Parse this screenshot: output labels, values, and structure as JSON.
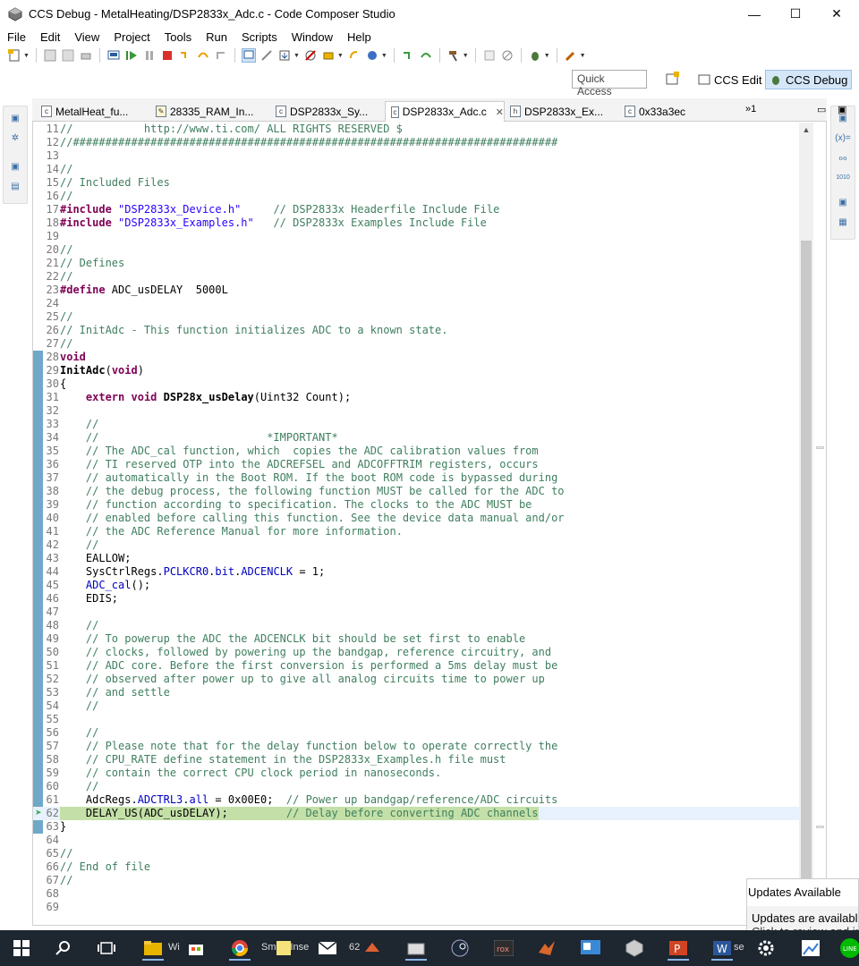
{
  "window": {
    "title": "CCS Debug - MetalHeating/DSP2833x_Adc.c - Code Composer Studio",
    "minimize": "—",
    "maximize": "☐",
    "close": "✕"
  },
  "menu": [
    "File",
    "Edit",
    "View",
    "Project",
    "Tools",
    "Run",
    "Scripts",
    "Window",
    "Help"
  ],
  "perspectives": {
    "quick_access": "Quick Access",
    "ccs_edit": "CCS Edit",
    "ccs_debug": "CCS Debug"
  },
  "tabs": [
    {
      "label": "MetalHeat_fu...",
      "icon": "c"
    },
    {
      "label": "28335_RAM_In...",
      "icon": "cmd"
    },
    {
      "label": "DSP2833x_Sy...",
      "icon": "c"
    },
    {
      "label": "DSP2833x_Adc.c",
      "icon": "c",
      "active": true
    },
    {
      "label": "DSP2833x_Ex...",
      "icon": "h"
    },
    {
      "label": "0x33a3ec",
      "icon": "c"
    }
  ],
  "tab_overflow": "»1",
  "code_lines": [
    {
      "n": "11",
      "html": "<span class=\"cm\">//           http://www.ti.com/ ALL RIGHTS RESERVED $</span>"
    },
    {
      "n": "12",
      "html": "<span class=\"cm\">//###########################################################################</span>"
    },
    {
      "n": "13",
      "html": ""
    },
    {
      "n": "14",
      "html": "<span class=\"cm\">//</span>"
    },
    {
      "n": "15",
      "html": "<span class=\"cm\">// Included Files</span>"
    },
    {
      "n": "16",
      "html": "<span class=\"cm\">//</span>"
    },
    {
      "n": "17",
      "html": "<span class=\"kw\">#include</span> <span class=\"st\">\"DSP2833x_Device.h\"</span>     <span class=\"cm\">// DSP2833x Headerfile Include File</span>"
    },
    {
      "n": "18",
      "html": "<span class=\"kw\">#include</span> <span class=\"st\">\"DSP2833x_Examples.h\"</span>   <span class=\"cm\">// DSP2833x Examples Include File</span>"
    },
    {
      "n": "19",
      "html": ""
    },
    {
      "n": "20",
      "html": "<span class=\"cm\">//</span>"
    },
    {
      "n": "21",
      "html": "<span class=\"cm\">// Defines</span>"
    },
    {
      "n": "22",
      "html": "<span class=\"cm\">//</span>"
    },
    {
      "n": "23",
      "html": "<span class=\"kw\">#define</span> ADC_usDELAY  5000L"
    },
    {
      "n": "24",
      "html": ""
    },
    {
      "n": "25",
      "html": "<span class=\"cm\">//</span>"
    },
    {
      "n": "26",
      "html": "<span class=\"cm\">// InitAdc - This function initializes ADC to a known state.</span>"
    },
    {
      "n": "27",
      "html": "<span class=\"cm\">//</span>"
    },
    {
      "n": "28",
      "html": "<span class=\"kw\">void</span>"
    },
    {
      "n": "29",
      "html": "<span class=\"fn\">InitAdc</span>(<span class=\"kw\">void</span>)"
    },
    {
      "n": "30",
      "html": "{"
    },
    {
      "n": "31",
      "html": "    <span class=\"kw\">extern</span> <span class=\"kw\">void</span> <span class=\"fn\">DSP28x_usDelay</span>(Uint32 Count);"
    },
    {
      "n": "32",
      "html": ""
    },
    {
      "n": "33",
      "html": "    <span class=\"cm\">//</span>"
    },
    {
      "n": "34",
      "html": "    <span class=\"cm\">//                          *IMPORTANT*</span>"
    },
    {
      "n": "35",
      "html": "    <span class=\"cm\">// The ADC_cal function, which  copies the ADC calibration values from</span>"
    },
    {
      "n": "36",
      "html": "    <span class=\"cm\">// TI reserved OTP into the ADCREFSEL and ADCOFFTRIM registers, occurs</span>"
    },
    {
      "n": "37",
      "html": "    <span class=\"cm\">// automatically in the Boot ROM. If the boot ROM code is bypassed during</span>"
    },
    {
      "n": "38",
      "html": "    <span class=\"cm\">// the debug process, the following function MUST be called for the ADC to</span>"
    },
    {
      "n": "39",
      "html": "    <span class=\"cm\">// function according to specification. The clocks to the ADC MUST be</span>"
    },
    {
      "n": "40",
      "html": "    <span class=\"cm\">// enabled before calling this function. See the device data manual and/or</span>"
    },
    {
      "n": "41",
      "html": "    <span class=\"cm\">// the ADC Reference Manual for more information.</span>"
    },
    {
      "n": "42",
      "html": "    <span class=\"cm\">//</span>"
    },
    {
      "n": "43",
      "html": "    EALLOW;"
    },
    {
      "n": "44",
      "html": "    SysCtrlRegs.<span class=\"fld\">PCLKCR0</span>.<span class=\"fld\">bit</span>.<span class=\"fld\">ADCENCLK</span> = 1;"
    },
    {
      "n": "45",
      "html": "    <span class=\"fld\">ADC_cal</span>();"
    },
    {
      "n": "46",
      "html": "    EDIS;"
    },
    {
      "n": "47",
      "html": ""
    },
    {
      "n": "48",
      "html": "    <span class=\"cm\">//</span>"
    },
    {
      "n": "49",
      "html": "    <span class=\"cm\">// To powerup the ADC the ADCENCLK bit should be set first to enable</span>"
    },
    {
      "n": "50",
      "html": "    <span class=\"cm\">// clocks, followed by powering up the bandgap, reference circuitry, and</span>"
    },
    {
      "n": "51",
      "html": "    <span class=\"cm\">// ADC core. Before the first conversion is performed a 5ms delay must be</span>"
    },
    {
      "n": "52",
      "html": "    <span class=\"cm\">// observed after power up to give all analog circuits time to power up</span>"
    },
    {
      "n": "53",
      "html": "    <span class=\"cm\">// and settle</span>"
    },
    {
      "n": "54",
      "html": "    <span class=\"cm\">//</span>"
    },
    {
      "n": "55",
      "html": ""
    },
    {
      "n": "56",
      "html": "    <span class=\"cm\">//</span>"
    },
    {
      "n": "57",
      "html": "    <span class=\"cm\">// Please note that for the delay function below to operate correctly the</span>"
    },
    {
      "n": "58",
      "html": "    <span class=\"cm\">// CPU_RATE define statement in the DSP2833x_Examples.h file must</span>"
    },
    {
      "n": "59",
      "html": "    <span class=\"cm\">// contain the correct CPU clock period in nanoseconds.</span>"
    },
    {
      "n": "60",
      "html": "    <span class=\"cm\">//</span>"
    },
    {
      "n": "61",
      "html": "    AdcRegs.<span class=\"fld\">ADCTRL3</span>.<span class=\"fld\">all</span> = 0x00E0;  <span class=\"cm\">// Power up bandgap/reference/ADC circuits</span>"
    },
    {
      "n": "62",
      "html": "    DELAY_US(ADC_usDELAY);         <span class=\"cm\">// Delay before converting ADC channels</span>",
      "current": true
    },
    {
      "n": "63",
      "html": "}"
    },
    {
      "n": "64",
      "html": ""
    },
    {
      "n": "65",
      "html": "<span class=\"cm\">//</span>"
    },
    {
      "n": "66",
      "html": "<span class=\"cm\">// End of file</span>"
    },
    {
      "n": "67",
      "html": "<span class=\"cm\">//</span>"
    },
    {
      "n": "68",
      "html": ""
    },
    {
      "n": "69",
      "html": ""
    }
  ],
  "notification": {
    "title": "Updates Available",
    "body_line1": "Updates are available",
    "body_line2": "Click to review and ins"
  },
  "taskbar": {
    "items": [
      "start",
      "search",
      "task-view",
      "file-explorer",
      "store",
      "chrome",
      "sticky-notes",
      "mail",
      "matlab",
      "steam",
      "xilinx",
      "matlab-2",
      "remote",
      "virtualbox",
      "powerpoint",
      "word",
      "calculator",
      "line"
    ],
    "labels": {
      "smart_insert": "Smart Inse",
      "num_62": "62"
    }
  }
}
